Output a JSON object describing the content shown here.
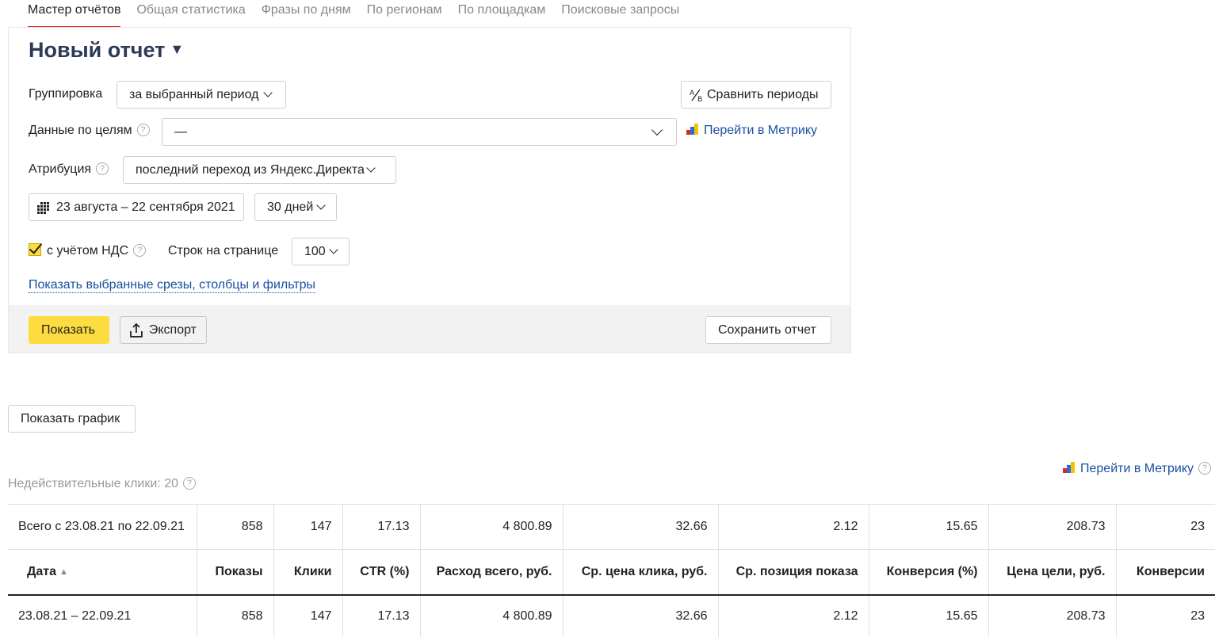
{
  "tabs": [
    "Мастер отчётов",
    "Общая статистика",
    "Фразы по дням",
    "По регионам",
    "По площадкам",
    "Поисковые запросы"
  ],
  "panel": {
    "title": "Новый отчет",
    "title_caret": "▼",
    "grouping_label": "Группировка",
    "grouping_value": "за выбранный период",
    "compare_button": "Сравнить периоды",
    "goals_label": "Данные по целям",
    "goals_value": "—",
    "metrika_link": "Перейти в Метрику",
    "attribution_label": "Атрибуция",
    "attribution_value": "последний переход из Яндекс.Директа",
    "date_range": "23 августа – 22 сентября 2021",
    "period_value": "30 дней",
    "vat_label": "с учётом НДС",
    "vat_checked": true,
    "rows_label": "Строк на странице",
    "rows_value": "100",
    "show_filters_link": "Показать выбранные срезы, столбцы и фильтры",
    "show_button": "Показать",
    "export_button": "Экспорт",
    "save_button": "Сохранить отчет"
  },
  "chart_button": "Показать график",
  "metrika_link_2": "Перейти в Метрику",
  "invalid_clicks": "Недействительные клики: 20",
  "table": {
    "summary": [
      "Всего с 23.08.21 по 22.09.21",
      "858",
      "147",
      "17.13",
      "4 800.89",
      "32.66",
      "2.12",
      "15.65",
      "208.73",
      "23"
    ],
    "headers": [
      "Дата",
      "Показы",
      "Клики",
      "CTR (%)",
      "Расход всего, руб.",
      "Ср. цена клика, руб.",
      "Ср. позиция показа",
      "Конверсия (%)",
      "Цена цели, руб.",
      "Конверсии"
    ],
    "rows": [
      [
        "23.08.21 – 22.09.21",
        "858",
        "147",
        "17.13",
        "4 800.89",
        "32.66",
        "2.12",
        "15.65",
        "208.73",
        "23"
      ]
    ]
  },
  "colors": {
    "accent_yellow": "#fddc3f",
    "link_blue": "#1a4fa0",
    "active_tab_red": "#e2261b",
    "title_color": "#2b3a55"
  }
}
